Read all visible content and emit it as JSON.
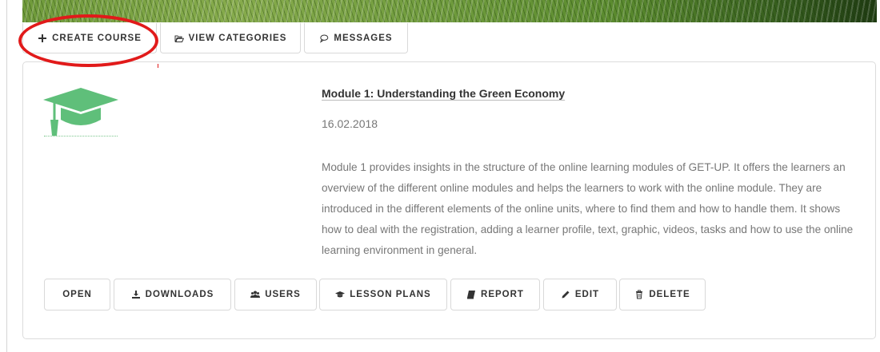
{
  "nav": {
    "create_course": "CREATE COURSE",
    "view_categories": "VIEW CATEGORIES",
    "messages": "MESSAGES"
  },
  "course": {
    "title": "Module 1: Understanding the Green Economy",
    "date": "16.02.2018",
    "description": "Module 1 provides insights in the structure of the online learning modules of GET-UP. It offers the learners an overview of the different online modules and helps the learners to work with the online module. They are introduced in the different elements of the online units, where to find them and how to handle them. It shows how to deal with the registration, adding a learner profile, text, graphic, videos, tasks and how to use the online learning environment in general.",
    "icon": "graduation-cap-icon",
    "icon_color": "#5fbf7a"
  },
  "actions": {
    "open": "OPEN",
    "downloads": "DOWNLOADS",
    "users": "USERS",
    "lesson_plans": "LESSON PLANS",
    "report": "REPORT",
    "edit": "EDIT",
    "delete": "DELETE"
  },
  "colors": {
    "annotation": "#e11a1a",
    "text": "#333333",
    "muted": "#777777"
  }
}
